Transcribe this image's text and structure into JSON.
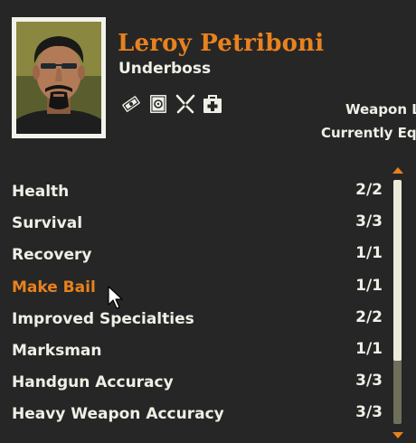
{
  "character": {
    "name": "Leroy Petriboni",
    "rank": "Underboss"
  },
  "specialties": [
    "cash-icon",
    "safe-icon",
    "pliers-icon",
    "medkit-icon"
  ],
  "header": {
    "weapon_label": "Weapon L",
    "equipped_label": "Currently Equ"
  },
  "skills": [
    {
      "name": "Health",
      "value": "2/2"
    },
    {
      "name": "Survival",
      "value": "3/3"
    },
    {
      "name": "Recovery",
      "value": "1/1"
    },
    {
      "name": "Make Bail",
      "value": "1/1"
    },
    {
      "name": "Improved Specialties",
      "value": "2/2"
    },
    {
      "name": "Marksman",
      "value": "1/1"
    },
    {
      "name": "Handgun Accuracy",
      "value": "3/3"
    },
    {
      "name": "Heavy Weapon Accuracy",
      "value": "3/3"
    }
  ],
  "colors": {
    "accent": "#e8821e",
    "text": "#efefe6",
    "background": "#262626"
  }
}
